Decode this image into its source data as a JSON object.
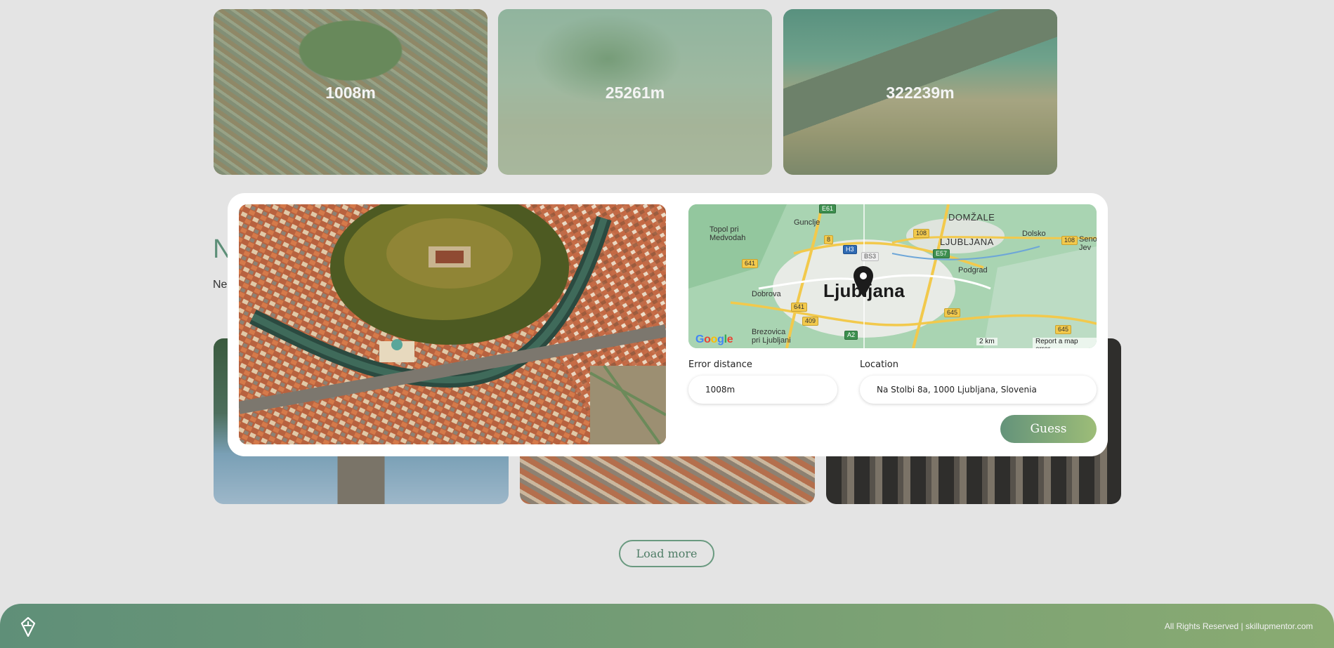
{
  "gallery": [
    {
      "distance": "1008m",
      "scene": "city-castle"
    },
    {
      "distance": "25261m",
      "scene": "palm-beach"
    },
    {
      "distance": "322239m",
      "scene": "coastal-cliffs"
    }
  ],
  "background_section": {
    "heading_visible": "N",
    "subtitle_visible": "Ne"
  },
  "modal": {
    "map": {
      "city_label": "Ljubljana",
      "places": [
        "Guncljе",
        "Topol pri Medvodah",
        "DOMŽALE",
        "LJUBLJANA",
        "Dolsko",
        "Podgrad",
        "Dobrova",
        "Brezovica pri Ljubljani",
        "Seno Jev"
      ],
      "shields": [
        "E61",
        "108",
        "H3",
        "BS3",
        "E57",
        "641",
        "8",
        "641",
        "409",
        "A2",
        "645",
        "645",
        "108"
      ],
      "attribution": "Google",
      "scale": "2 km",
      "report": "Report a map error"
    },
    "error_distance": {
      "label": "Error distance",
      "value": "1008m"
    },
    "location": {
      "label": "Location",
      "value": "Na Stolbi 8a, 1000 Ljubljana, Slovenia"
    },
    "guess_label": "Guess"
  },
  "load_more_label": "Load more",
  "footer": {
    "copyright": "All Rights Reserved | skillupmentor.com"
  },
  "colors": {
    "accent": "#5f8f78",
    "accent_light": "#9dbd78",
    "background": "#e4e4e4"
  }
}
